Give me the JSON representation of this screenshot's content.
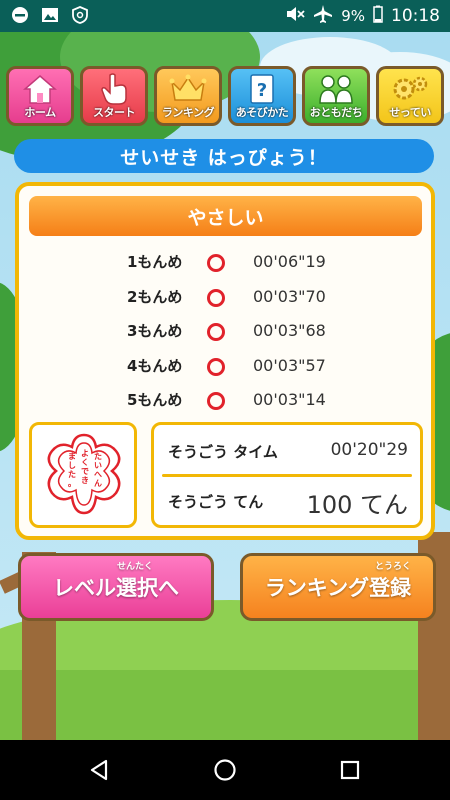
{
  "status_bar": {
    "battery": "9%",
    "time": "10:18"
  },
  "menu": [
    {
      "label": "ホーム",
      "icon": "home-icon"
    },
    {
      "label": "スタート",
      "icon": "hand-pointer-icon"
    },
    {
      "label": "ランキング",
      "icon": "crown-icon"
    },
    {
      "label": "あそびかた",
      "icon": "question-icon"
    },
    {
      "label": "おともだち",
      "icon": "friends-icon"
    },
    {
      "label": "せってい",
      "icon": "gears-icon"
    }
  ],
  "banner": "せいせき はっぴょう！",
  "level": "やさしい",
  "results": [
    {
      "label": "1もんめ",
      "time": "00'06\"19"
    },
    {
      "label": "2もんめ",
      "time": "00'03\"70"
    },
    {
      "label": "3もんめ",
      "time": "00'03\"68"
    },
    {
      "label": "4もんめ",
      "time": "00'03\"57"
    },
    {
      "label": "5もんめ",
      "time": "00'03\"14"
    }
  ],
  "stamp_text": "たいへん よくでき ました。",
  "total": {
    "time_label": "そうごう タイム",
    "time_value": "00'20\"29",
    "score_label": "そうごう てん",
    "score_value": "100 てん"
  },
  "buttons": {
    "level_select": "レベル選択へ",
    "level_select_ruby": "せんたく",
    "ranking_register": "ランキング登録",
    "ranking_register_ruby": "とうろく"
  },
  "colors": {
    "accent_pink": "#ea3f97",
    "accent_orange": "#f5821f",
    "banner_blue": "#1f8fe6",
    "border_gold": "#f2b705",
    "mark_red": "#e1222b"
  }
}
